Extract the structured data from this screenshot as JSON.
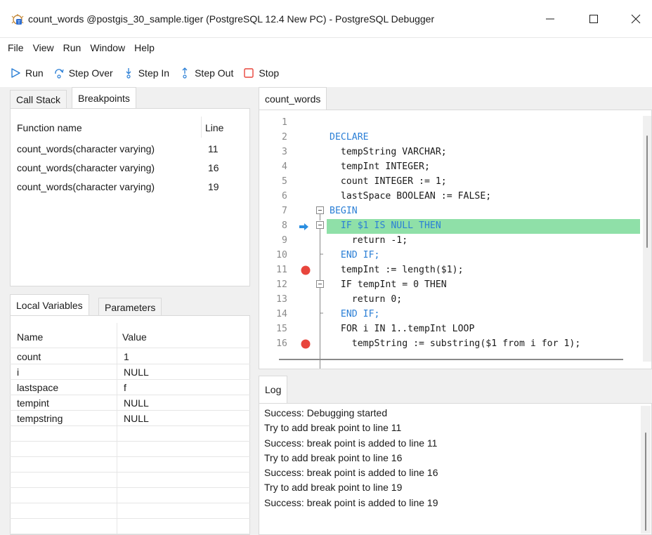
{
  "window": {
    "title": "count_words @postgis_30_sample.tiger (PostgreSQL 12.4 New PC) - PostgreSQL Debugger",
    "controls": {
      "minimize": "—",
      "maximize": "☐",
      "close": "✕"
    }
  },
  "menu": [
    "File",
    "View",
    "Run",
    "Window",
    "Help"
  ],
  "toolbar": {
    "run": "Run",
    "step_over": "Step Over",
    "step_in": "Step In",
    "step_out": "Step Out",
    "stop": "Stop"
  },
  "left_top_tabs": [
    "Call Stack",
    "Breakpoints"
  ],
  "breakpoints": {
    "headers": {
      "function": "Function name",
      "line": "Line"
    },
    "rows": [
      {
        "function": "count_words(character varying)",
        "line": "11"
      },
      {
        "function": "count_words(character varying)",
        "line": "16"
      },
      {
        "function": "count_words(character varying)",
        "line": "19"
      }
    ]
  },
  "left_bottom_tabs": [
    "Local Variables",
    "Parameters"
  ],
  "variables": {
    "headers": {
      "name": "Name",
      "value": "Value"
    },
    "rows": [
      {
        "name": "count",
        "value": "1"
      },
      {
        "name": "i",
        "value": "NULL"
      },
      {
        "name": "lastspace",
        "value": "f"
      },
      {
        "name": "tempint",
        "value": "NULL"
      },
      {
        "name": "tempstring",
        "value": "NULL"
      }
    ]
  },
  "editor": {
    "tab": "count_words",
    "current_line": 8,
    "breakpoint_lines": [
      11,
      16
    ],
    "lines": [
      {
        "n": "1",
        "text": ""
      },
      {
        "n": "2",
        "text": "DECLARE"
      },
      {
        "n": "3",
        "text": "  tempString VARCHAR;"
      },
      {
        "n": "4",
        "text": "  tempInt INTEGER;"
      },
      {
        "n": "5",
        "text": "  count INTEGER := 1;"
      },
      {
        "n": "6",
        "text": "  lastSpace BOOLEAN := FALSE;"
      },
      {
        "n": "7",
        "text": "BEGIN"
      },
      {
        "n": "8",
        "text": "  IF $1 IS NULL THEN"
      },
      {
        "n": "9",
        "text": "    return -1;"
      },
      {
        "n": "10",
        "text": "  END IF;"
      },
      {
        "n": "11",
        "text": "  tempInt := length($1);"
      },
      {
        "n": "12",
        "text": "  IF tempInt = 0 THEN"
      },
      {
        "n": "13",
        "text": "    return 0;"
      },
      {
        "n": "14",
        "text": "  END IF;"
      },
      {
        "n": "15",
        "text": "  FOR i IN 1..tempInt LOOP"
      },
      {
        "n": "16",
        "text": "    tempString := substring($1 from i for 1);"
      }
    ]
  },
  "log": {
    "tab": "Log",
    "lines": [
      "Success: Debugging started",
      "Try to add break point to line 11",
      "Success: break point is added to line 11",
      "Try to add break point to line 16",
      "Success: break point is added to line 16",
      "Try to add break point to line 19",
      "Success: break point is added to line 19"
    ]
  },
  "colors": {
    "current_line": "#8fe0a8",
    "keyword": "#2b7fd6",
    "number": "#1aa36f",
    "breakpoint": "#e8453c",
    "arrow": "#2b8ee0"
  }
}
